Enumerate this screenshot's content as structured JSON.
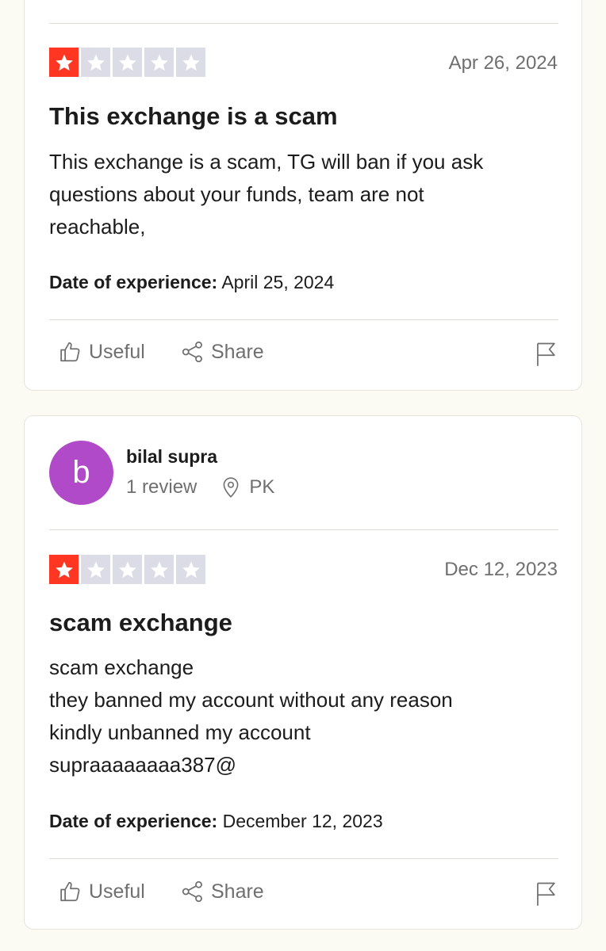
{
  "colors": {
    "star_filled": "#ff3722",
    "star_empty": "#dcdce6",
    "avatar": "#b04ac8"
  },
  "reviews": [
    {
      "rating": 1,
      "date": "Apr 26, 2024",
      "title": "This exchange is a scam",
      "body_lines": [
        "This exchange is a scam, TG will ban if you ask",
        "questions about your funds, team are not",
        "reachable,"
      ],
      "experience_label": "Date of experience:",
      "experience_date": "April 25, 2024",
      "useful_label": "Useful",
      "share_label": "Share"
    },
    {
      "reviewer": {
        "initial": "b",
        "name": "bilal supra",
        "review_count": "1 review",
        "country": "PK"
      },
      "rating": 1,
      "date": "Dec 12, 2023",
      "title": "scam exchange",
      "body_lines": [
        "scam exchange",
        "they banned my account without any reason",
        "kindly unbanned my account",
        "supraaaaaaaa387@"
      ],
      "experience_label": "Date of experience:",
      "experience_date": "December 12, 2023",
      "useful_label": "Useful",
      "share_label": "Share"
    }
  ]
}
